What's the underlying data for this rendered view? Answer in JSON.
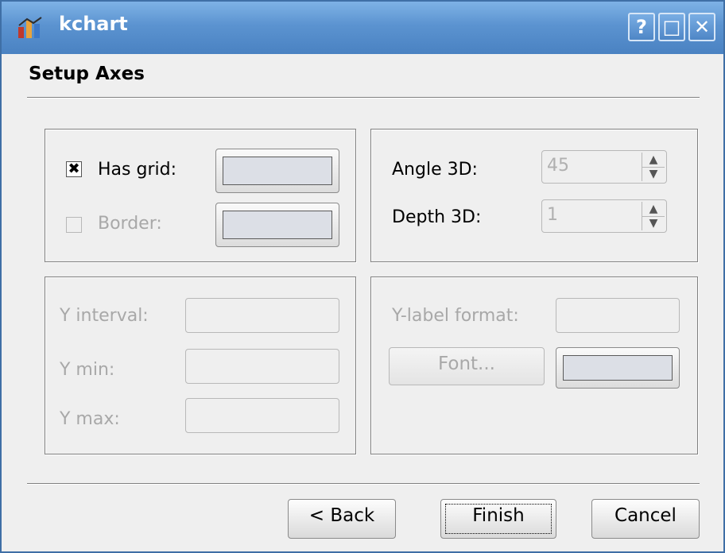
{
  "window": {
    "title": "kchart",
    "controls": {
      "help": "?",
      "maximize": "□",
      "close": "✕"
    },
    "accent_color": "#5B93D0"
  },
  "page": {
    "heading": "Setup Axes"
  },
  "grid_group": {
    "has_grid": {
      "label": "Has grid:",
      "checked": true,
      "check_mark": "✖"
    },
    "border": {
      "label": "Border:",
      "checked": false,
      "enabled": false
    }
  },
  "threed_group": {
    "angle": {
      "label": "Angle 3D:",
      "value": "45"
    },
    "depth": {
      "label": "Depth 3D:",
      "value": "1"
    }
  },
  "y_group": {
    "interval": {
      "label": "Y interval:",
      "value": ""
    },
    "min": {
      "label": "Y min:",
      "value": ""
    },
    "max": {
      "label": "Y max:",
      "value": ""
    }
  },
  "label_group": {
    "format": {
      "label": "Y-label format:",
      "value": ""
    },
    "font_button": "Font..."
  },
  "footer": {
    "back": "< Back",
    "finish": "Finish",
    "cancel": "Cancel"
  },
  "spin_glyphs": {
    "up": "▲",
    "down": "▼"
  }
}
